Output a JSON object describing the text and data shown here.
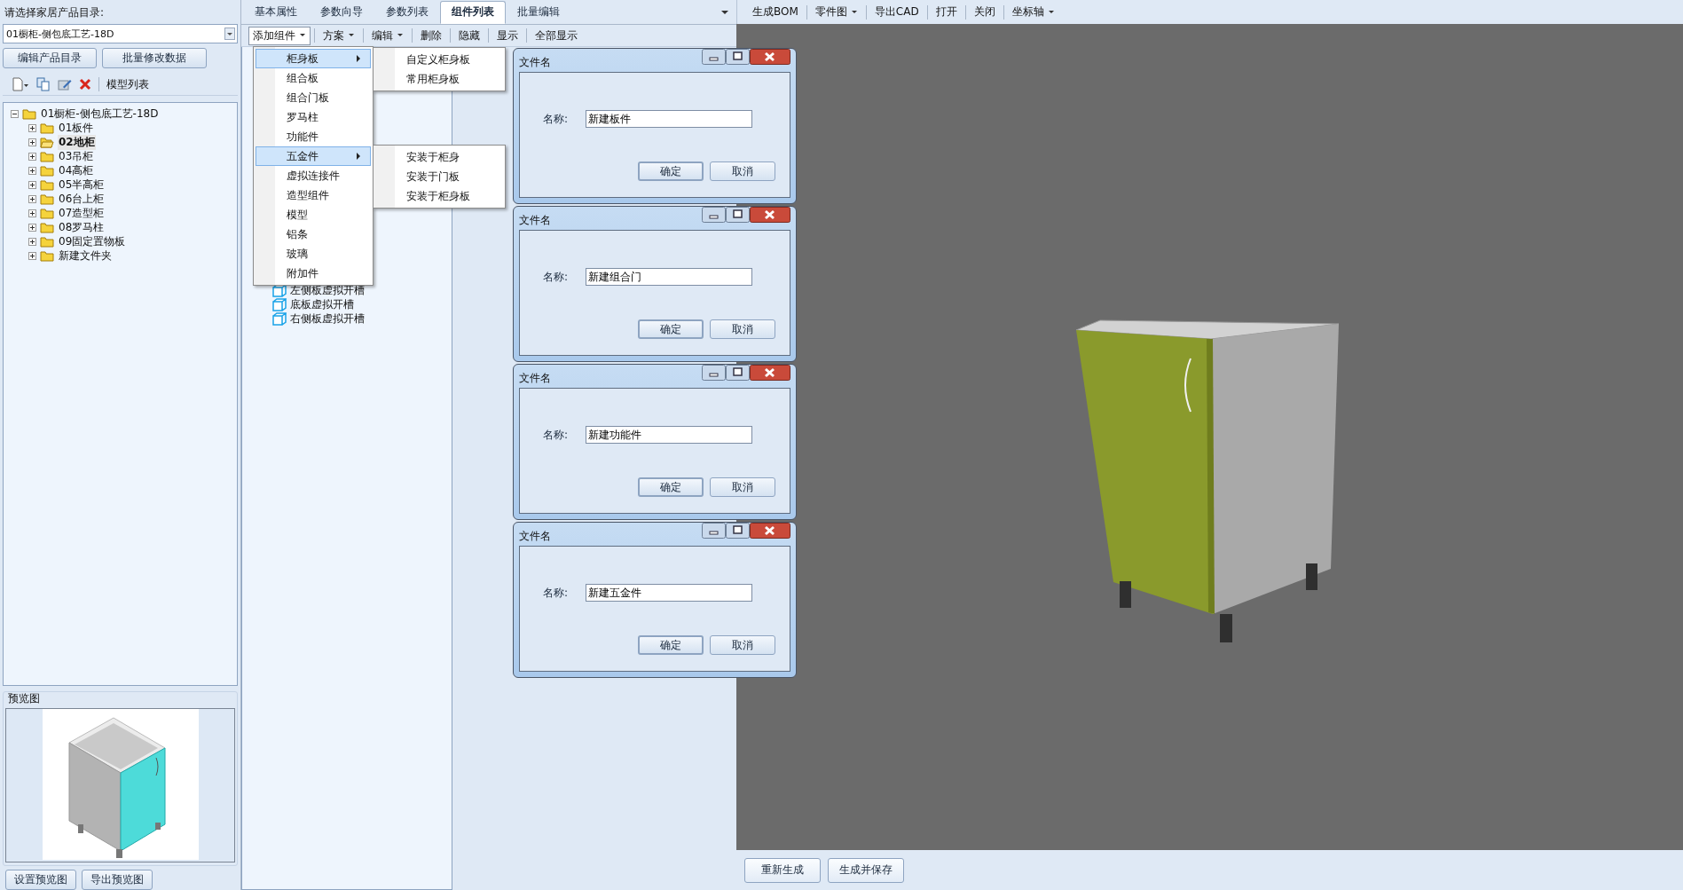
{
  "catalog": {
    "label": "请选择家居产品目录:",
    "value": "01橱柜-侧包底工艺-18D"
  },
  "catalog_buttons": [
    "编辑产品目录",
    "批量修改数据"
  ],
  "model_toolbar": {
    "label": "模型列表"
  },
  "model_tree": {
    "label": "01橱柜-侧包底工艺-18D",
    "expanded": true,
    "children": [
      {
        "label": "01板件",
        "selected": false,
        "expanded": false
      },
      {
        "label": "02地柜",
        "selected": true,
        "expanded": false
      },
      {
        "label": "03吊柜",
        "selected": false,
        "expanded": false
      },
      {
        "label": "04高柜",
        "selected": false,
        "expanded": false
      },
      {
        "label": "05半高柜",
        "selected": false,
        "expanded": false
      },
      {
        "label": "06台上柜",
        "selected": false,
        "expanded": false
      },
      {
        "label": "07造型柜",
        "selected": false,
        "expanded": false
      },
      {
        "label": "08罗马柱",
        "selected": false,
        "expanded": false
      },
      {
        "label": "09固定置物板",
        "selected": false,
        "expanded": false
      },
      {
        "label": "新建文件夹",
        "selected": false,
        "expanded": false
      }
    ]
  },
  "preview": {
    "title": "预览图",
    "buttons": [
      "设置预览图",
      "导出预览图"
    ]
  },
  "tabs": [
    {
      "label": "基本属性",
      "selected": false
    },
    {
      "label": "参数向导",
      "selected": false
    },
    {
      "label": "参数列表",
      "selected": false
    },
    {
      "label": "组件列表",
      "selected": true
    },
    {
      "label": "批量编辑",
      "selected": false
    }
  ],
  "component_toolbar": [
    {
      "label": "添加组件",
      "kind": "dropdown"
    },
    {
      "label": "方案",
      "kind": "dropdown"
    },
    {
      "label": "编辑",
      "kind": "dropdown"
    },
    {
      "label": "删除",
      "kind": "button"
    },
    {
      "label": "隐藏",
      "kind": "button"
    },
    {
      "label": "显示",
      "kind": "button"
    },
    {
      "label": "全部显示",
      "kind": "button"
    }
  ],
  "component_tree": [
    "左侧板虚拟开槽",
    "底板虚拟开槽",
    "右侧板虚拟开槽"
  ],
  "add_menu": [
    {
      "label": "柜身板",
      "highlighted": true,
      "submenu": [
        "自定义柜身板",
        "常用柜身板"
      ]
    },
    {
      "label": "组合板",
      "highlighted": false
    },
    {
      "label": "组合门板",
      "highlighted": false
    },
    {
      "label": "罗马柱",
      "highlighted": false
    },
    {
      "label": "功能件",
      "highlighted": false
    },
    {
      "label": "五金件",
      "highlighted": true,
      "submenu": [
        "安装于柜身",
        "安装于门板",
        "安装于柜身板"
      ]
    },
    {
      "label": "虚拟连接件",
      "highlighted": false
    },
    {
      "label": "造型组件",
      "highlighted": false
    },
    {
      "label": "模型",
      "highlighted": false
    },
    {
      "label": "铝条",
      "highlighted": false
    },
    {
      "label": "玻璃",
      "highlighted": false
    },
    {
      "label": "附加件",
      "highlighted": false
    }
  ],
  "view_toolbar": [
    {
      "label": "生成BOM",
      "kind": "button"
    },
    {
      "label": "零件图",
      "kind": "dropdown"
    },
    {
      "label": "导出CAD",
      "kind": "button"
    },
    {
      "label": "打开",
      "kind": "button"
    },
    {
      "label": "关闭",
      "kind": "button"
    },
    {
      "label": "坐标轴",
      "kind": "dropdown"
    }
  ],
  "dialogs": [
    {
      "title": "文件名",
      "field_label": "名称:",
      "value": "新建板件",
      "buttons": [
        "确定",
        "取消"
      ]
    },
    {
      "title": "文件名",
      "field_label": "名称:",
      "value": "新建组合门",
      "buttons": [
        "确定",
        "取消"
      ]
    },
    {
      "title": "文件名",
      "field_label": "名称:",
      "value": "新建功能件",
      "buttons": [
        "确定",
        "取消"
      ]
    },
    {
      "title": "文件名",
      "field_label": "名称:",
      "value": "新建五金件",
      "buttons": [
        "确定",
        "取消"
      ]
    }
  ],
  "footer_buttons": [
    "重新生成",
    "生成并保存"
  ]
}
